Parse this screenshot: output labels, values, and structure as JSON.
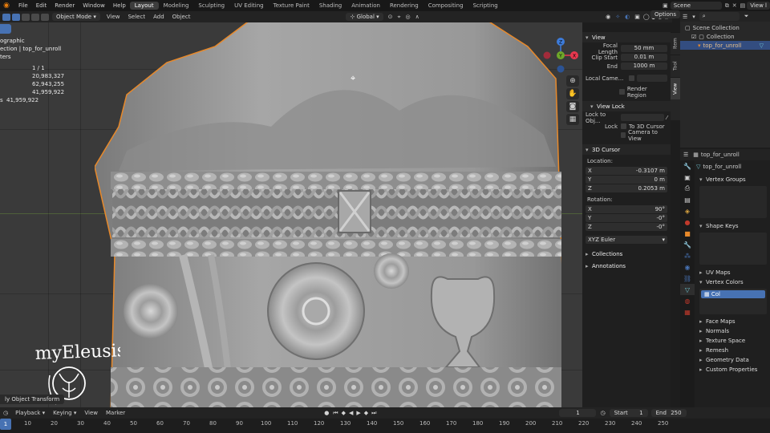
{
  "topbar": {
    "menus": [
      "File",
      "Edit",
      "Render",
      "Window",
      "Help"
    ],
    "workspaces": [
      "Layout",
      "Modeling",
      "Sculpting",
      "UV Editing",
      "Texture Paint",
      "Shading",
      "Animation",
      "Rendering",
      "Compositing",
      "Scripting"
    ],
    "active_workspace": "Layout",
    "scene": "Scene",
    "view_layer": "View l"
  },
  "viewport_header": {
    "mode": "Object Mode",
    "menus": [
      "View",
      "Select",
      "Add",
      "Object"
    ],
    "orientation": "Global",
    "options": "Options"
  },
  "overlay_text": {
    "view_name": "ographic",
    "collection": "ection | top_for_unroll",
    "objects_label": "ters",
    "stats": [
      {
        "label": "",
        "value": "1 / 1"
      },
      {
        "label": "",
        "value": "20,983,327"
      },
      {
        "label": "",
        "value": "62,943,255"
      },
      {
        "label": "",
        "value": "41,959,922"
      },
      {
        "label": "s",
        "value": "41,959,922"
      }
    ]
  },
  "gizmo": {
    "axes": [
      "X",
      "Y",
      "Z"
    ],
    "colors": {
      "x": "#e8384f",
      "y": "#6ea82a",
      "z": "#3d7bd9"
    }
  },
  "watermark": {
    "text": "myEleusis"
  },
  "last_operator": "ly Object Transform",
  "npanel": {
    "tabs": [
      "Item",
      "Tool",
      "View"
    ],
    "active_tab": "View",
    "view": {
      "title": "View",
      "focal_length_label": "Focal Length",
      "focal_length": "50 mm",
      "clip_start_label": "Clip Start",
      "clip_start": "0.01 m",
      "end_label": "End",
      "end": "1000 m",
      "local_camera_label": "Local Came...",
      "render_region_label": "Render Region"
    },
    "view_lock": {
      "title": "View Lock",
      "lock_to_obj_label": "Lock to Obj...",
      "lock_label": "Lock",
      "to_3d_cursor": "To 3D Cursor",
      "camera_to_view": "Camera to View"
    },
    "cursor": {
      "title": "3D Cursor",
      "location_label": "Location:",
      "location": [
        {
          "axis": "X",
          "value": "-0.3107 m"
        },
        {
          "axis": "Y",
          "value": "0 m"
        },
        {
          "axis": "Z",
          "value": "0.2053 m"
        }
      ],
      "rotation_label": "Rotation:",
      "rotation": [
        {
          "axis": "X",
          "value": "90°"
        },
        {
          "axis": "Y",
          "value": "-0°"
        },
        {
          "axis": "Z",
          "value": "-0°"
        }
      ],
      "mode": "XYZ Euler"
    },
    "collections": "Collections",
    "annotations": "Annotations"
  },
  "outliner": {
    "root": "Scene Collection",
    "collection": "Collection",
    "object": "top_for_unroll"
  },
  "properties": {
    "object_name": "top_for_unroll",
    "mesh_name": "top_for_unroll",
    "sections": {
      "vertex_groups": "Vertex Groups",
      "shape_keys": "Shape Keys",
      "uv_maps": "UV Maps",
      "vertex_colors": "Vertex Colors",
      "vertex_color_item": "Col",
      "face_maps": "Face Maps",
      "normals": "Normals",
      "texture_space": "Texture Space",
      "remesh": "Remesh",
      "geometry_data": "Geometry Data",
      "custom_properties": "Custom Properties"
    }
  },
  "timeline": {
    "playback": "Playback",
    "keying": "Keying",
    "view": "View",
    "marker": "Marker",
    "current_frame": "1",
    "start_label": "Start",
    "start": "1",
    "end_label": "End",
    "end": "250",
    "ruler": [
      "1",
      "10",
      "20",
      "30",
      "40",
      "50",
      "60",
      "70",
      "80",
      "90",
      "100",
      "110",
      "120",
      "130",
      "140",
      "150",
      "160",
      "170",
      "180",
      "190",
      "200",
      "210",
      "220",
      "230",
      "240",
      "250"
    ]
  },
  "colors": {
    "accent_blue": "#4772b3",
    "selection_orange": "#e8892a",
    "viewport_bg": "#3a3a3a"
  }
}
